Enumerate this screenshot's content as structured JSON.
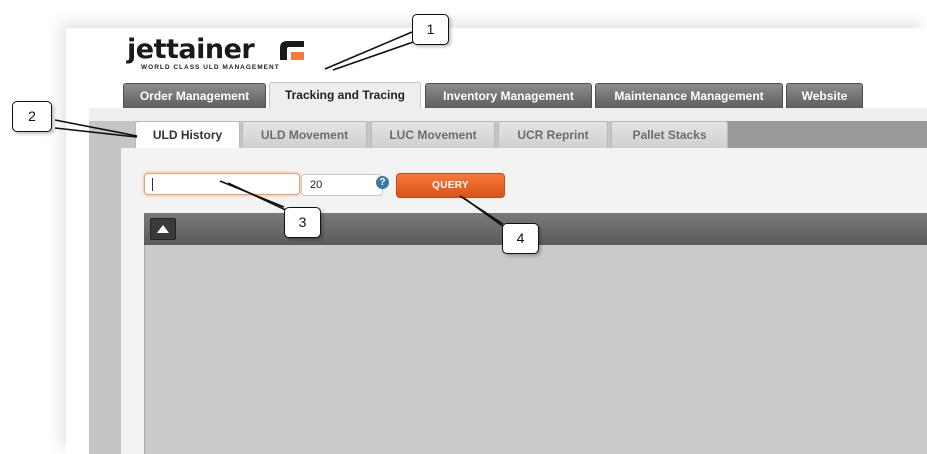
{
  "brand": {
    "name": "jettainer",
    "tagline": "WORLD CLASS ULD MANAGEMENT",
    "accent": "#f47a3a"
  },
  "main_tabs": [
    {
      "label": "Order Management",
      "active": false
    },
    {
      "label": "Tracking and Tracing",
      "active": true
    },
    {
      "label": "Inventory Management",
      "active": false
    },
    {
      "label": "Maintenance Management",
      "active": false
    },
    {
      "label": "Website",
      "active": false
    }
  ],
  "sub_tabs": [
    {
      "label": "ULD History",
      "active": true
    },
    {
      "label": "ULD Movement",
      "active": false
    },
    {
      "label": "LUC Movement",
      "active": false
    },
    {
      "label": "UCR Reprint",
      "active": false
    },
    {
      "label": "Pallet Stacks",
      "active": false
    }
  ],
  "form": {
    "search_value": "",
    "count_value": "20",
    "help_icon": "question-icon",
    "help_glyph": "?",
    "query_label": "QUERY"
  },
  "grid": {
    "collapse_icon": "triangle-up-icon"
  },
  "callouts": [
    "1",
    "2",
    "3",
    "4"
  ]
}
